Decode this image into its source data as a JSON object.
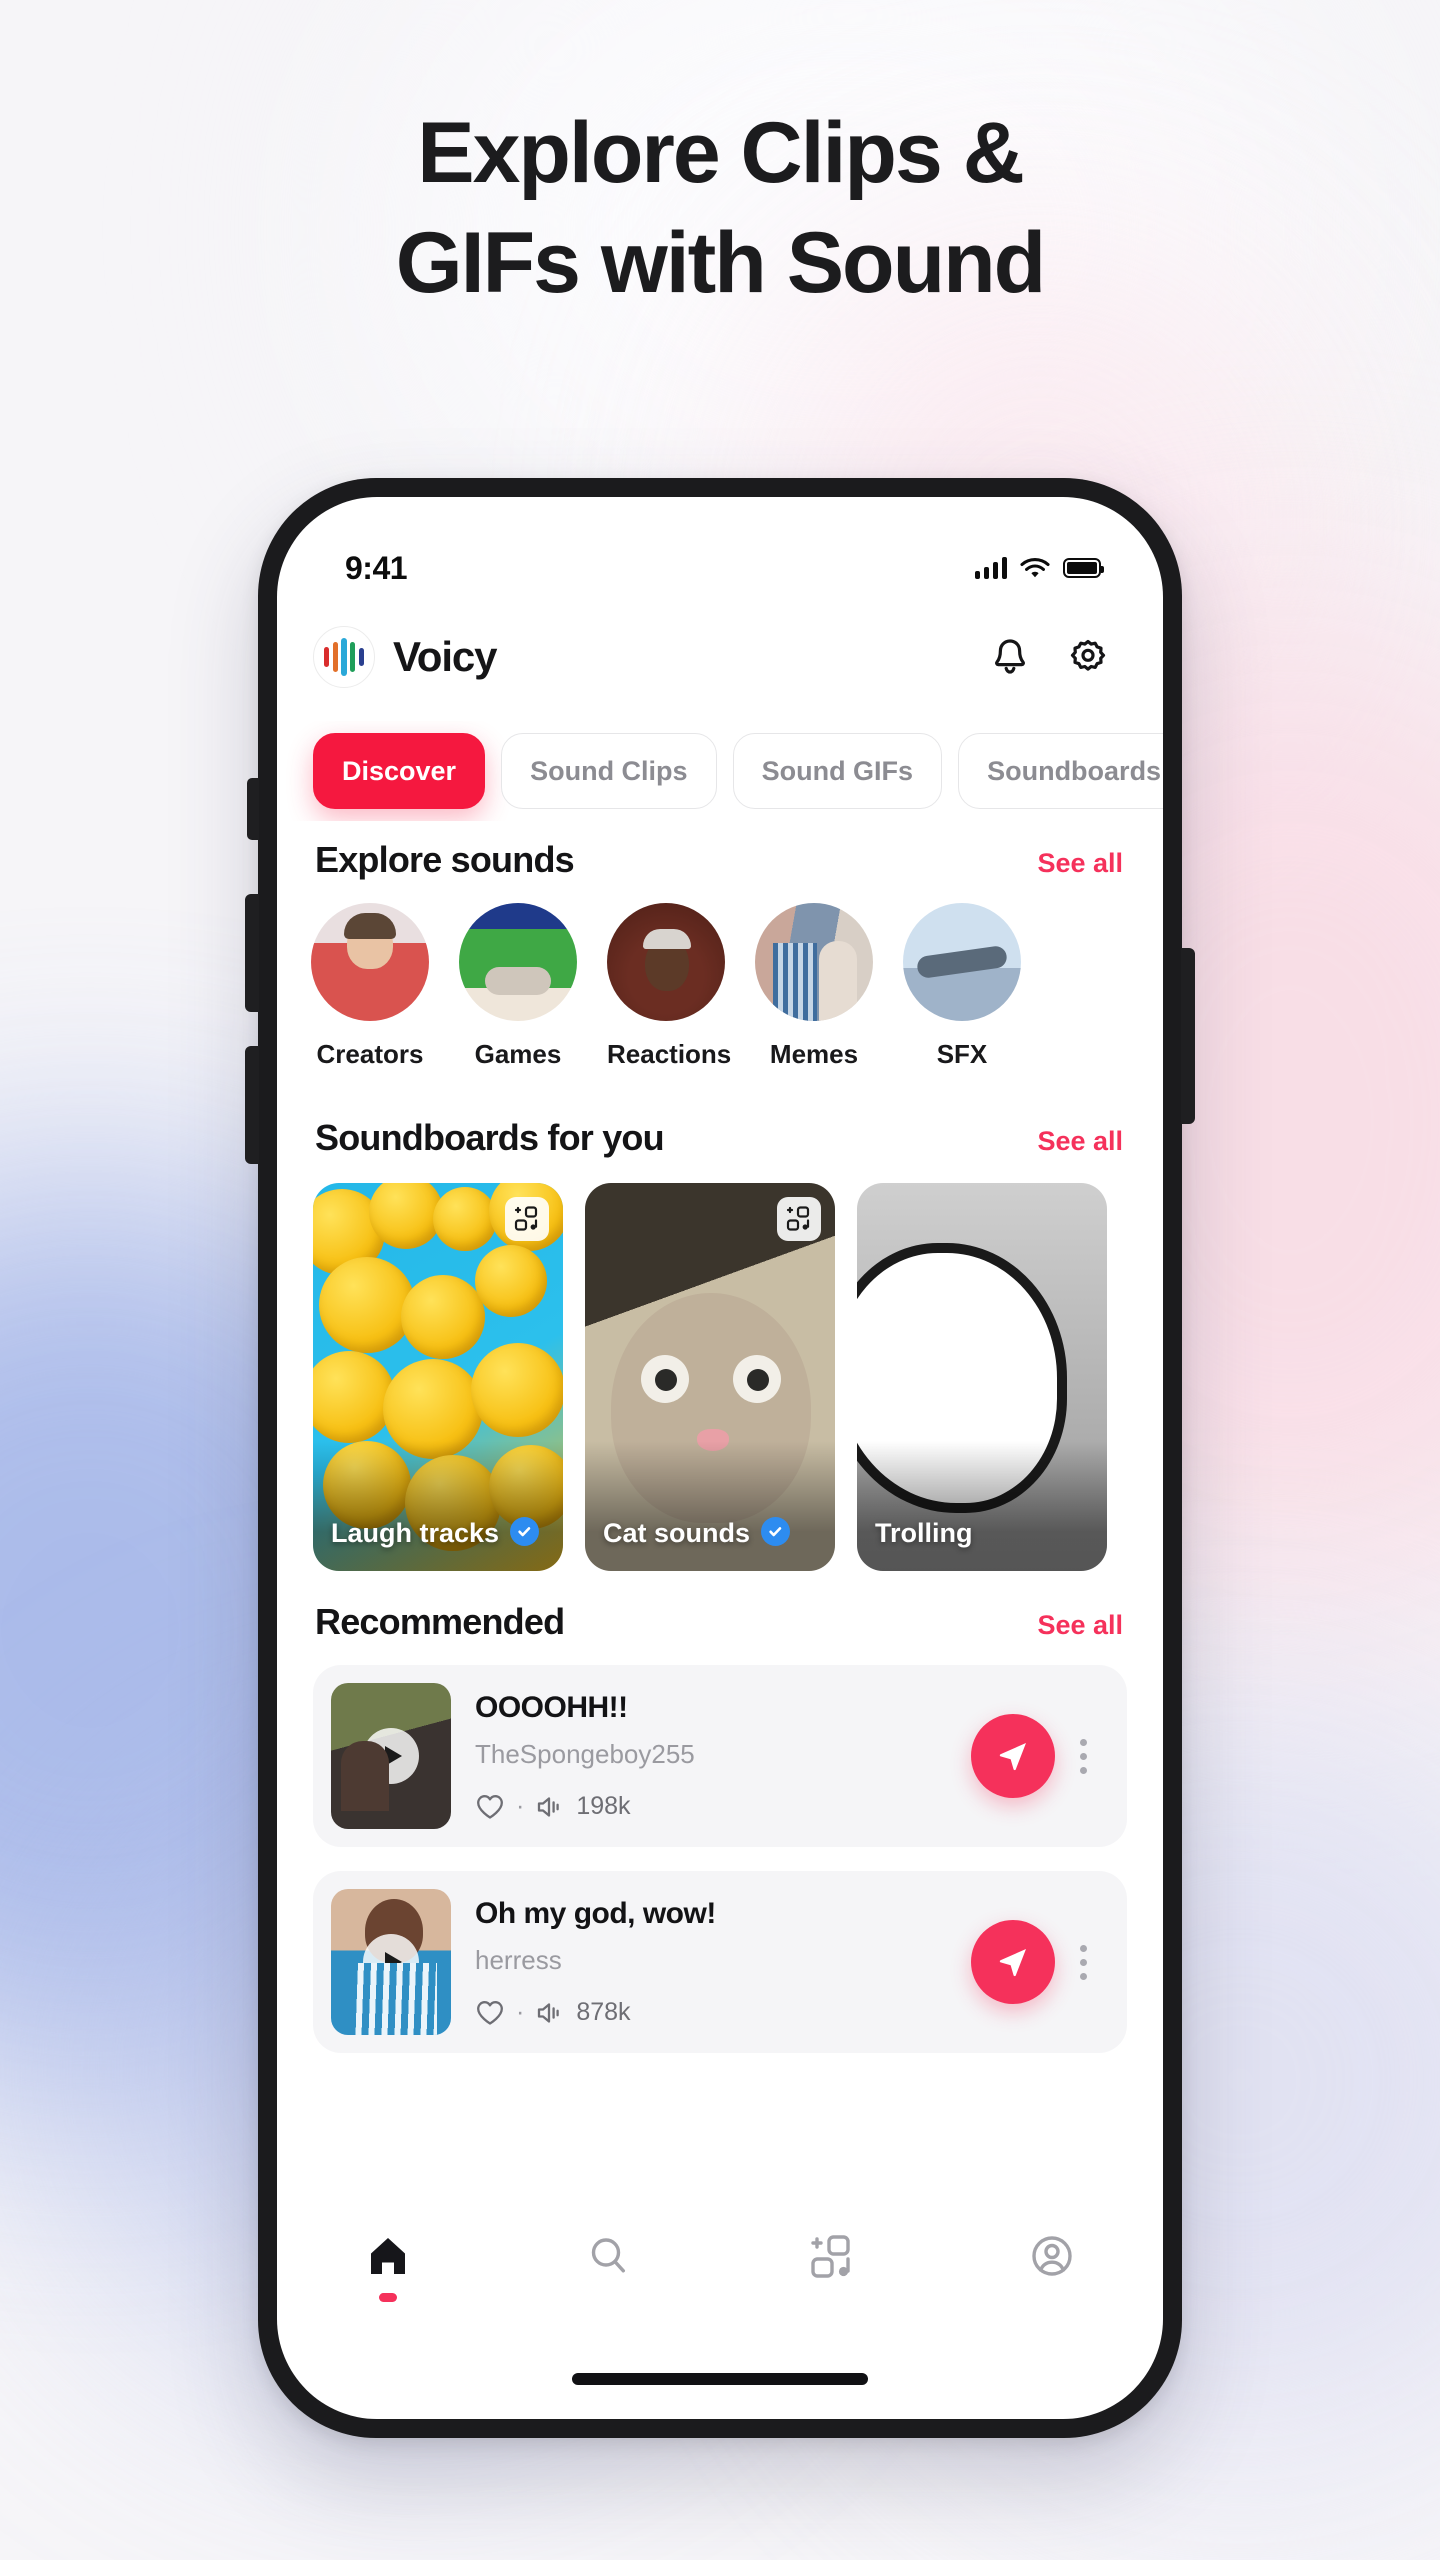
{
  "promo": {
    "headline_line1": "Explore Clips &",
    "headline_line2": "GIFs with Sound"
  },
  "colors": {
    "accent": "#f5183f",
    "accent_link": "#f5315b",
    "verified_blue": "#2d8cf0",
    "text_dark": "#141416",
    "text_muted": "#8c8c92"
  },
  "status_bar": {
    "time": "9:41",
    "signal_icon": "cellular-signal-icon",
    "wifi_icon": "wifi-icon",
    "battery_icon": "battery-full-icon"
  },
  "app_header": {
    "brand_name": "Voicy",
    "logo_icon": "voicy-waveform-logo",
    "logo_bar_colors": [
      "#d92d2d",
      "#e2702a",
      "#2aa8d8",
      "#1f9e5a",
      "#2a3f8f"
    ],
    "notifications_icon": "bell-icon",
    "settings_icon": "gear-icon"
  },
  "tabs": [
    {
      "label": "Discover",
      "active": true
    },
    {
      "label": "Sound Clips",
      "active": false
    },
    {
      "label": "Sound GIFs",
      "active": false
    },
    {
      "label": "Soundboards",
      "active": false
    }
  ],
  "explore": {
    "title": "Explore sounds",
    "see_all": "See all",
    "categories": [
      {
        "label": "Creators",
        "thumb": "creator-portrait-red-hoodie"
      },
      {
        "label": "Games",
        "thumb": "game-controller-soccer"
      },
      {
        "label": "Reactions",
        "thumb": "surprised-face-portrait"
      },
      {
        "label": "Memes",
        "thumb": "distracted-boyfriend-meme"
      },
      {
        "label": "SFX",
        "thumb": "cargo-airplane"
      }
    ]
  },
  "soundboards": {
    "title": "Soundboards for you",
    "see_all": "See all",
    "badge_icon": "add-sound-icon",
    "verified_icon": "verified-check-icon",
    "items": [
      {
        "name": "Laugh tracks",
        "verified": true,
        "art": "laughing-emoji-pile"
      },
      {
        "name": "Cat sounds",
        "verified": true,
        "art": "surprised-cat-photo"
      },
      {
        "name": "Trolling",
        "verified": false,
        "art": "troll-face-meme"
      }
    ]
  },
  "recommended": {
    "title": "Recommended",
    "see_all": "See all",
    "like_icon": "heart-outline-icon",
    "plays_icon": "speaker-wave-icon",
    "share_icon": "send-paper-plane-icon",
    "more_icon": "kebab-menu-icon",
    "play_icon": "play-triangle-icon",
    "separator": "·",
    "items": [
      {
        "title": "OOOOHH!!",
        "author": "TheSpongeboy255",
        "plays": "198k",
        "thumb": "crowd-reaction-clip"
      },
      {
        "title": "Oh my god, wow!",
        "author": "herress",
        "plays": "878k",
        "thumb": "man-shouting-clip"
      }
    ]
  },
  "bottom_nav": [
    {
      "icon": "home-icon",
      "label": "Home",
      "active": true
    },
    {
      "icon": "search-icon",
      "label": "Search",
      "active": false
    },
    {
      "icon": "add-sound-icon",
      "label": "Create",
      "active": false
    },
    {
      "icon": "profile-icon",
      "label": "Profile",
      "active": false
    }
  ]
}
